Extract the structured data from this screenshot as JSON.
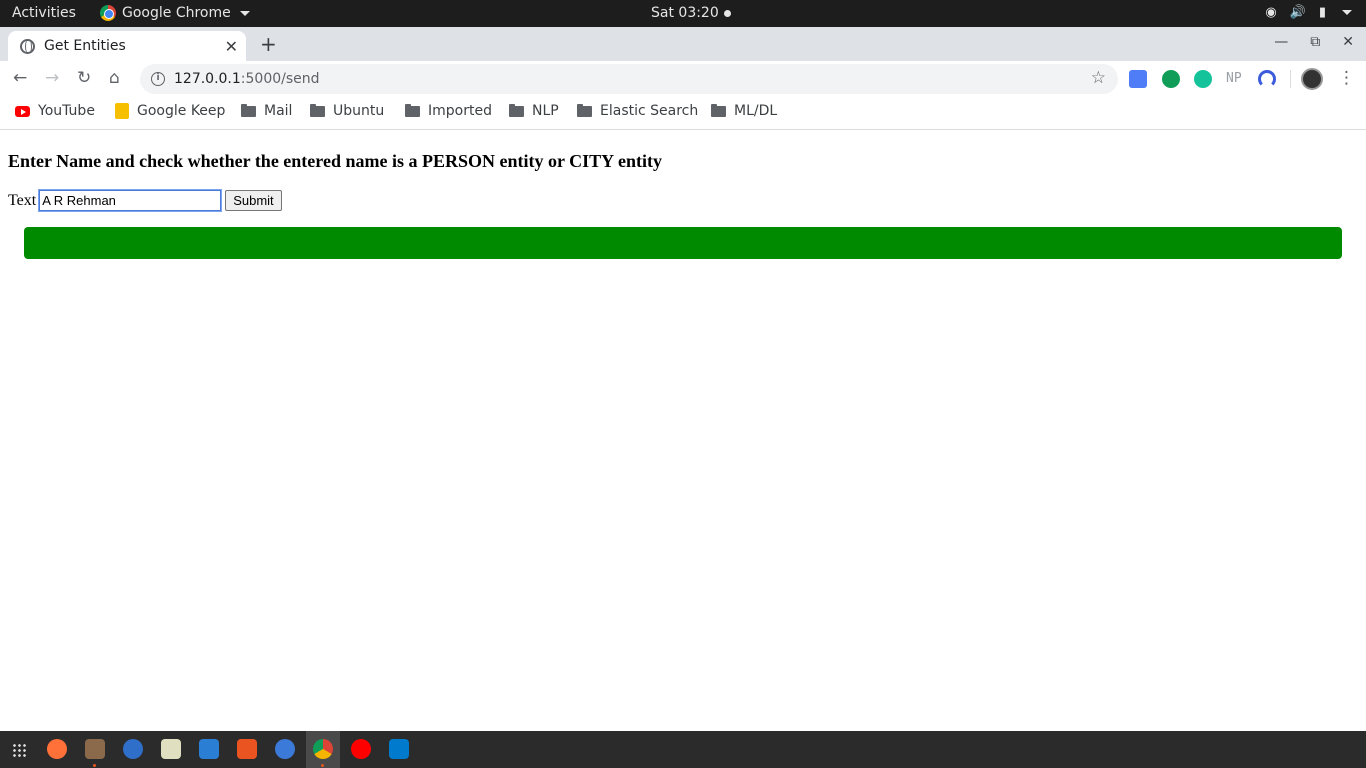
{
  "system_bar": {
    "activities": "Activities",
    "app_name": "Google Chrome",
    "clock": "Sat 03:20"
  },
  "browser": {
    "tab_title": "Get Entities",
    "url_host": "127.0.0.1",
    "url_path": ":5000/send",
    "extensions": [
      {
        "icon": "translate-icon",
        "color": "#4f7cf7"
      },
      {
        "icon": "hangouts-icon",
        "color": "#0f9d58"
      },
      {
        "icon": "grammarly-icon",
        "color": "#15c39a"
      },
      {
        "icon": "np-icon",
        "text": "NP"
      },
      {
        "icon": "reload-extension-icon",
        "color": "#3b5bdb"
      }
    ]
  },
  "bookmarks": [
    {
      "label": "YouTube",
      "icon": "youtube-icon"
    },
    {
      "label": "Google Keep",
      "icon": "keep-icon"
    },
    {
      "label": "Mail",
      "icon": "folder-icon"
    },
    {
      "label": "Ubuntu",
      "icon": "folder-icon"
    },
    {
      "label": "Imported",
      "icon": "folder-icon"
    },
    {
      "label": "NLP",
      "icon": "folder-icon"
    },
    {
      "label": "Elastic Search",
      "icon": "folder-icon"
    },
    {
      "label": "ML/DL",
      "icon": "folder-icon"
    }
  ],
  "page": {
    "heading": "Enter Name and check whether the entered name is a PERSON entity or CITY entity",
    "input_label": "Text",
    "input_value": "A R Rehman",
    "submit_label": "Submit",
    "result_color": "#008a00"
  },
  "dock": [
    {
      "icon": "apps-grid-icon"
    },
    {
      "icon": "firefox-icon",
      "color": "#ff7139"
    },
    {
      "icon": "files-icon",
      "color": "#8a6a4a"
    },
    {
      "icon": "thunderbird-icon",
      "color": "#2f6fc9"
    },
    {
      "icon": "keepass-icon",
      "color": "#e0e0c0"
    },
    {
      "icon": "document-viewer-icon",
      "color": "#2a7fd4"
    },
    {
      "icon": "software-center-icon",
      "color": "#e95420"
    },
    {
      "icon": "help-icon",
      "color": "#3c7ad9"
    },
    {
      "icon": "chrome-icon",
      "color": "#db4437"
    },
    {
      "icon": "youtube-music-icon",
      "color": "#ff0000"
    },
    {
      "icon": "vscode-icon",
      "color": "#007acc"
    }
  ]
}
